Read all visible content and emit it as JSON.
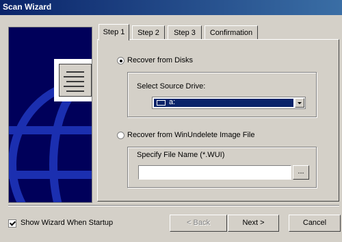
{
  "window": {
    "title": "Scan Wizard"
  },
  "tabs": [
    {
      "label": "Step 1",
      "active": true
    },
    {
      "label": "Step 2",
      "active": false
    },
    {
      "label": "Step 3",
      "active": false
    },
    {
      "label": "Confirmation",
      "active": false
    }
  ],
  "options": {
    "recover_disks": {
      "label": "Recover from Disks",
      "checked": true
    },
    "select_source_drive_label": "Select Source Drive:",
    "source_drive_value": "a:",
    "recover_image": {
      "label": "Recover from WinUndelete Image File",
      "checked": false
    },
    "file_name_label": "Specify File Name (*.WUI)",
    "file_name_value": "",
    "browse_label": "..."
  },
  "footer": {
    "show_wizard_label": "Show Wizard When Startup",
    "show_wizard_checked": true,
    "back_label": "< Back",
    "next_label": "Next >",
    "cancel_label": "Cancel"
  },
  "icons": {
    "sidebar_art": "globe-document-icon",
    "drive": "floppy-drive-icon",
    "dropdown": "chevron-down-icon"
  },
  "colors": {
    "titlebar": "#0a246a",
    "selection": "#0a246a",
    "sidebar_background": "#00005a",
    "window_background": "#d4d0c8"
  }
}
